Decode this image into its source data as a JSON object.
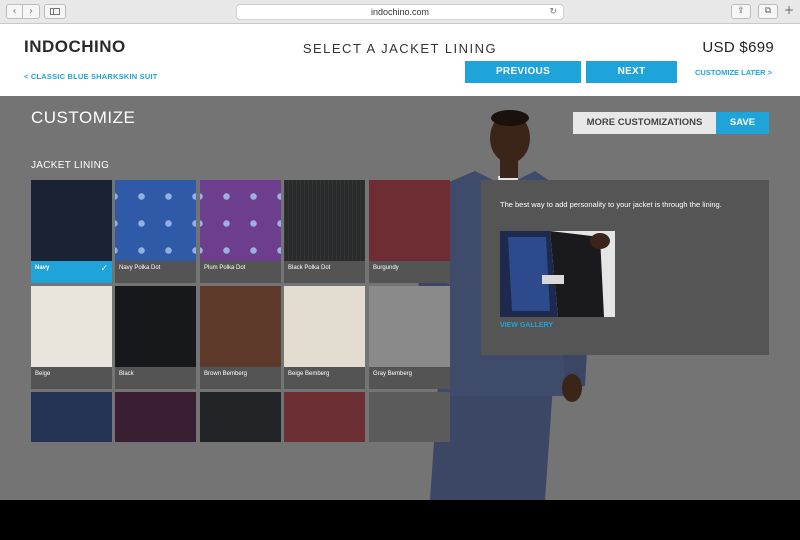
{
  "browser": {
    "url": "indochino.com",
    "back_icon": "chevron-left-icon",
    "forward_icon": "chevron-right-icon"
  },
  "header": {
    "logo": "INDOCHINO",
    "back_link": "< CLASSIC BLUE SHARKSKIN SUIT",
    "title": "SELECT A JACKET LINING",
    "price": "USD $699",
    "previous_label": "PREVIOUS",
    "next_label": "NEXT",
    "customize_later": "CUSTOMIZE LATER >"
  },
  "customize": {
    "title": "CUSTOMIZE",
    "more_label": "MORE CUSTOMIZATIONS",
    "save_label": "SAVE",
    "section_label": "JACKET LINING"
  },
  "swatches": [
    {
      "label": "Navy",
      "color": "#1b2233",
      "selected": true
    },
    {
      "label": "Navy Polka Dot",
      "color": "#2f5aa8",
      "pattern": "dots"
    },
    {
      "label": "Plum Polka Dot",
      "color": "#6d3d8e",
      "pattern": "dots"
    },
    {
      "label": "Black Polka Dot",
      "color": "#2a2b2c",
      "pattern": "stripes"
    },
    {
      "label": "Burgundy",
      "color": "#6e2d33"
    },
    {
      "label": "Beige",
      "color": "#e9e5dc"
    },
    {
      "label": "Black",
      "color": "#17181c"
    },
    {
      "label": "Brown Bemberg",
      "color": "#5e3a2a"
    },
    {
      "label": "Beige Bemberg",
      "color": "#e2ddd0"
    },
    {
      "label": "Gray Bemberg",
      "color": "#8a8a8a"
    },
    {
      "label": "",
      "color": "#243253"
    },
    {
      "label": "",
      "color": "#3a1e32"
    },
    {
      "label": "",
      "color": "#222326"
    },
    {
      "label": "",
      "color": "#6b2f34"
    },
    {
      "label": "",
      "color": "#5b5b5b"
    }
  ],
  "info": {
    "text": "The best way to add personality to your jacket is through the lining.",
    "view_gallery": "VIEW GALLERY"
  },
  "colors": {
    "accent": "#1ea4d9",
    "panel": "#555555",
    "background": "#747474"
  }
}
